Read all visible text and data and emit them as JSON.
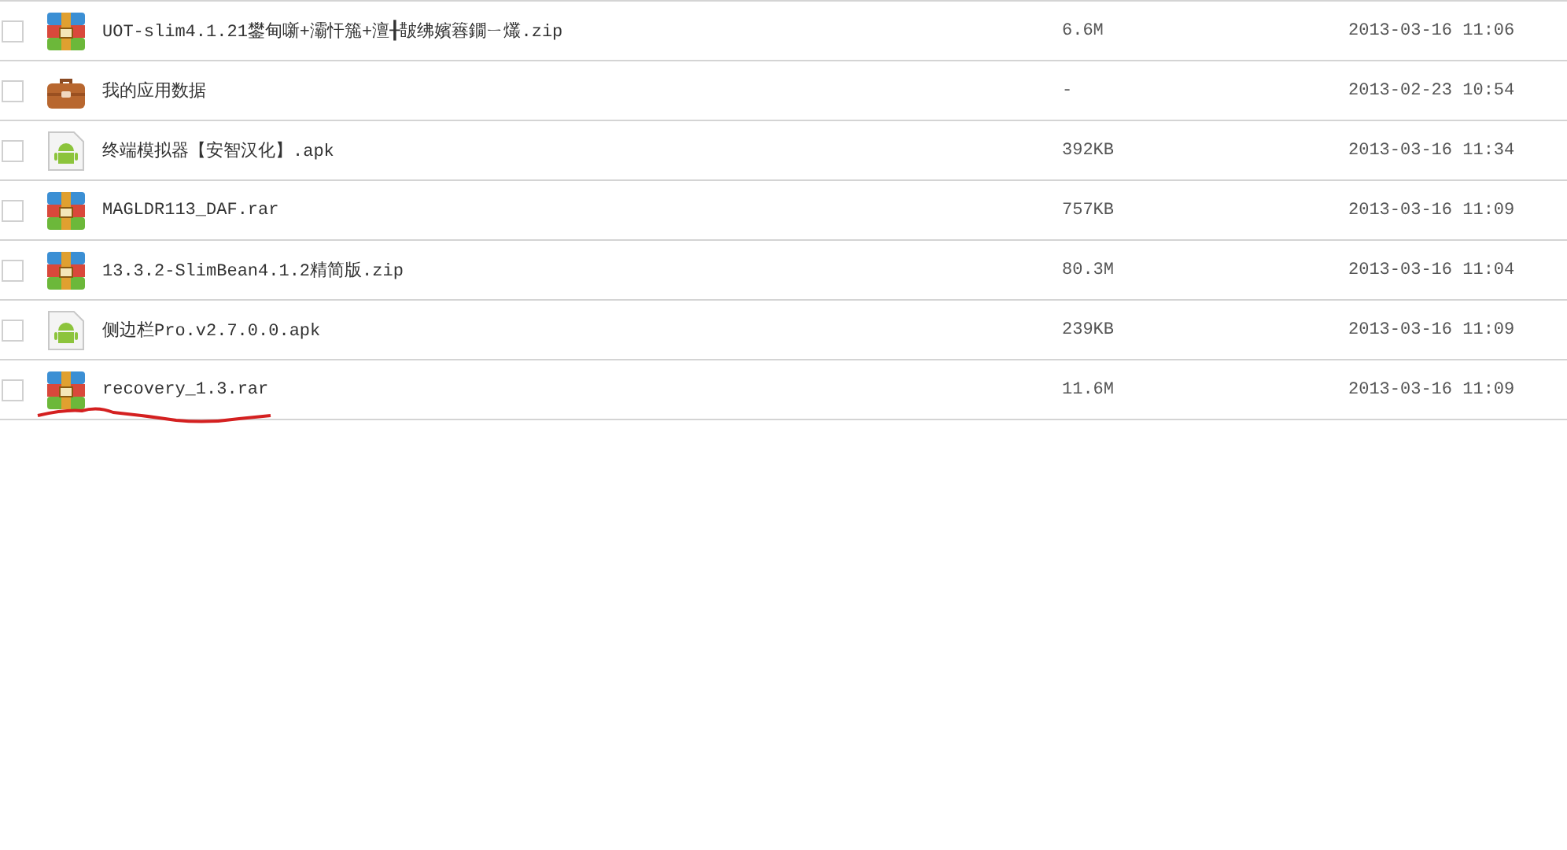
{
  "files": [
    {
      "kind": "archive",
      "name": "UOT-slim4.1.21鐢甸噺+灞忓箷+澶╂皵绋嬪簭鐗ㄧ爜.zip",
      "size": "6.6M",
      "modified": "2013-03-16 11:06",
      "checked": false,
      "underlined": false
    },
    {
      "kind": "folder",
      "name": "我的应用数据",
      "size": "-",
      "modified": "2013-02-23 10:54",
      "checked": false,
      "underlined": false
    },
    {
      "kind": "apk",
      "name": "终端模拟器【安智汉化】.apk",
      "size": "392KB",
      "modified": "2013-03-16 11:34",
      "checked": false,
      "underlined": false
    },
    {
      "kind": "archive",
      "name": "MAGLDR113_DAF.rar",
      "size": "757KB",
      "modified": "2013-03-16 11:09",
      "checked": false,
      "underlined": false
    },
    {
      "kind": "archive",
      "name": "13.3.2-SlimBean4.1.2精简版.zip",
      "size": "80.3M",
      "modified": "2013-03-16 11:04",
      "checked": false,
      "underlined": false
    },
    {
      "kind": "apk",
      "name": "侧边栏Pro.v2.7.0.0.apk",
      "size": "239KB",
      "modified": "2013-03-16 11:09",
      "checked": false,
      "underlined": false
    },
    {
      "kind": "archive",
      "name": "recovery_1.3.rar",
      "size": "11.6M",
      "modified": "2013-03-16 11:09",
      "checked": false,
      "underlined": true
    }
  ]
}
